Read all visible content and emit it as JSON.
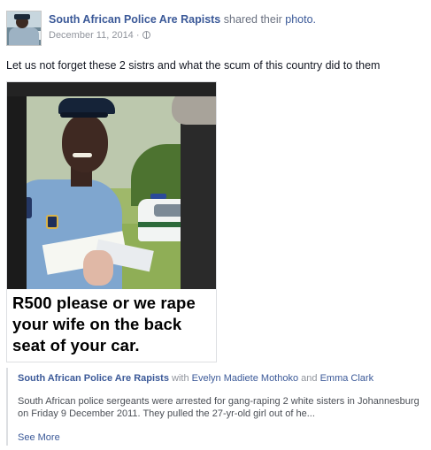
{
  "post": {
    "page_name": "South African Police Are Rapists",
    "shared_text": "shared their",
    "photo_link": "photo.",
    "date": "December 11, 2014 ·",
    "caption": "Let us not forget these 2 sistrs and what the scum of this country did to them"
  },
  "photo": {
    "meme_lines": [
      "R500 please or we rape",
      "your wife on the back",
      "seat of your car."
    ]
  },
  "shared_post": {
    "page_name": "South African Police Are Rapists",
    "with_text": "with",
    "person1": "Evelyn Madiete Mothoko",
    "and_text": "and",
    "person2": "Emma Clark",
    "body_lines": [
      "South African police sergeants were arrested for gang-raping 2 white sisters in Johannesburg",
      "on Friday 9 December 2011. They pulled the 27-yr-old girl out of he..."
    ],
    "see_more": "See More"
  },
  "icons": {
    "privacy": "globe-icon"
  },
  "colors": {
    "link": "#3b5998",
    "text": "#141823",
    "muted": "#90949c"
  }
}
